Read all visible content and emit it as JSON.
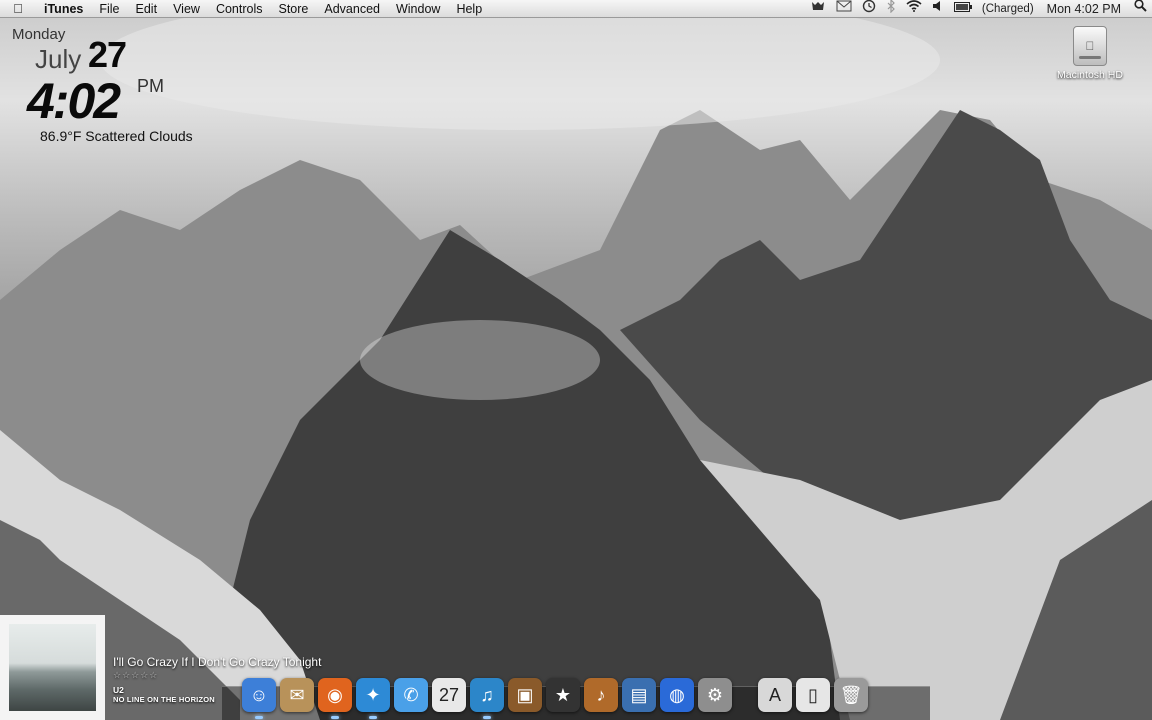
{
  "menubar": {
    "apple_glyph": "",
    "app_name": "iTunes",
    "items": [
      "File",
      "Edit",
      "View",
      "Controls",
      "Store",
      "Advanced",
      "Window",
      "Help"
    ],
    "status": {
      "battery": "(Charged)",
      "clock": "Mon 4:02 PM"
    },
    "status_icons": [
      "growl-icon",
      "mail-icon",
      "time-machine-icon",
      "bluetooth-icon",
      "wifi-icon",
      "volume-icon",
      "battery-icon",
      "spotlight-icon"
    ]
  },
  "widget": {
    "day": "Monday",
    "month": "July",
    "date": "27",
    "time": "4:02",
    "ampm": "PM",
    "weather": "86.9°F  Scattered Clouds"
  },
  "desktop": {
    "disk_label": "Macintosh HD"
  },
  "now_playing": {
    "song": "I'll Go Crazy If I Don't Go Crazy Tonight",
    "rating": "☆☆☆☆☆",
    "artist": "U2",
    "album": "NO LINE ON THE HORIZON"
  },
  "dock": {
    "apps": [
      {
        "name": "finder-icon",
        "glyph": "☺",
        "color": "#3d7fd8",
        "running": true
      },
      {
        "name": "mail-stamp-icon",
        "glyph": "✉",
        "color": "#b8925a",
        "running": false
      },
      {
        "name": "firefox-icon",
        "glyph": "◉",
        "color": "#e0641e",
        "running": true
      },
      {
        "name": "safari-icon",
        "glyph": "✦",
        "color": "#2d8ad6",
        "running": true
      },
      {
        "name": "ichat-icon",
        "glyph": "✆",
        "color": "#4aa0e8",
        "running": false
      },
      {
        "name": "ical-icon",
        "glyph": "27",
        "color": "#e8e8e8",
        "running": false
      },
      {
        "name": "itunes-icon",
        "glyph": "♫",
        "color": "#2c86c9",
        "running": true
      },
      {
        "name": "iphoto-icon",
        "glyph": "▣",
        "color": "#8a5a2a",
        "running": false
      },
      {
        "name": "imovie-icon",
        "glyph": "★",
        "color": "#333333",
        "running": false
      },
      {
        "name": "garageband-icon",
        "glyph": "♪",
        "color": "#b06a2a",
        "running": false
      },
      {
        "name": "documents-stack-icon",
        "glyph": "▤",
        "color": "#3a6fb0",
        "running": false
      },
      {
        "name": "google-earth-icon",
        "glyph": "◍",
        "color": "#2a6ad8",
        "running": false
      },
      {
        "name": "system-preferences-icon",
        "glyph": "⚙",
        "color": "#8e8e8e",
        "running": false
      }
    ],
    "stacks": [
      {
        "name": "applications-stack-icon",
        "glyph": "A",
        "color": "#d8d8d8"
      },
      {
        "name": "documents-folder-icon",
        "glyph": "▯",
        "color": "#e6e6e6"
      },
      {
        "name": "trash-icon",
        "glyph": "🗑",
        "color": "#9a9a9a"
      }
    ]
  }
}
